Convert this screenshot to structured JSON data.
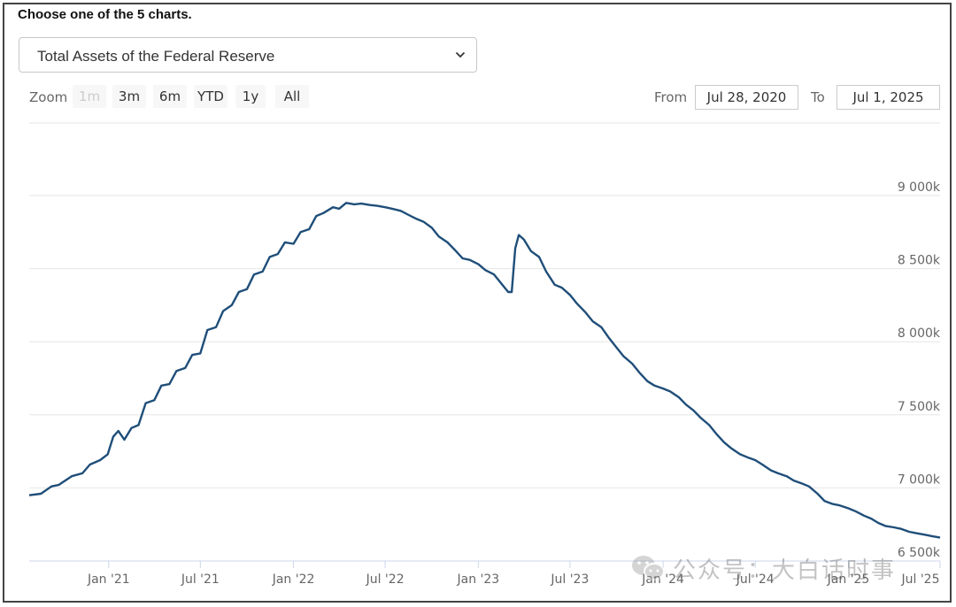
{
  "prompt": "Choose one of the 5 charts.",
  "selector": {
    "selected": "Total Assets of the Federal Reserve"
  },
  "zoom": {
    "label": "Zoom",
    "buttons": [
      {
        "label": "1m",
        "disabled": true
      },
      {
        "label": "3m",
        "disabled": false
      },
      {
        "label": "6m",
        "disabled": false
      },
      {
        "label": "YTD",
        "disabled": false
      },
      {
        "label": "1y",
        "disabled": false
      },
      {
        "label": "All",
        "disabled": false
      }
    ]
  },
  "range": {
    "from_label": "From",
    "from_value": "Jul 28, 2020",
    "to_label": "To",
    "to_value": "Jul 1, 2025"
  },
  "watermark": {
    "text": "公众号：大白话时事",
    "icon": "wechat-icon"
  },
  "colors": {
    "line": "#1f4e79",
    "grid": "#e6e6e6",
    "axis": "#ccd6eb"
  },
  "chart_data": {
    "type": "line",
    "title": "",
    "xlabel": "",
    "ylabel": "",
    "xlim": [
      "2020-07-28",
      "2025-07-01"
    ],
    "ylim": [
      6500,
      9000
    ],
    "grid": true,
    "y_ticks": [
      {
        "value": 6500,
        "label": "6 500k"
      },
      {
        "value": 7000,
        "label": "7 000k"
      },
      {
        "value": 7500,
        "label": "7 500k"
      },
      {
        "value": 8000,
        "label": "8 000k"
      },
      {
        "value": 8500,
        "label": "8 500k"
      },
      {
        "value": 9000,
        "label": "9 000k"
      }
    ],
    "x_ticks": [
      {
        "date": "2021-01-01",
        "label": "Jan '21"
      },
      {
        "date": "2021-07-01",
        "label": "Jul '21"
      },
      {
        "date": "2022-01-01",
        "label": "Jan '22"
      },
      {
        "date": "2022-07-01",
        "label": "Jul '22"
      },
      {
        "date": "2023-01-01",
        "label": "Jan '23"
      },
      {
        "date": "2023-07-01",
        "label": "Jul '23"
      },
      {
        "date": "2024-01-01",
        "label": "Jan '24"
      },
      {
        "date": "2024-07-01",
        "label": "Jul '24"
      },
      {
        "date": "2025-01-01",
        "label": "Jan '25"
      },
      {
        "date": "2025-07-01",
        "label": "Jul '25"
      }
    ],
    "series": [
      {
        "points": [
          [
            "2020-07-28",
            6950
          ],
          [
            "2020-08-20",
            6960
          ],
          [
            "2020-09-10",
            7010
          ],
          [
            "2020-09-24",
            7020
          ],
          [
            "2020-10-20",
            7080
          ],
          [
            "2020-11-10",
            7100
          ],
          [
            "2020-11-25",
            7160
          ],
          [
            "2020-12-15",
            7190
          ],
          [
            "2020-12-30",
            7230
          ],
          [
            "2021-01-10",
            7350
          ],
          [
            "2021-01-20",
            7390
          ],
          [
            "2021-02-01",
            7330
          ],
          [
            "2021-02-15",
            7410
          ],
          [
            "2021-03-01",
            7430
          ],
          [
            "2021-03-15",
            7580
          ],
          [
            "2021-04-01",
            7600
          ],
          [
            "2021-04-15",
            7700
          ],
          [
            "2021-05-01",
            7710
          ],
          [
            "2021-05-15",
            7800
          ],
          [
            "2021-06-01",
            7820
          ],
          [
            "2021-06-15",
            7910
          ],
          [
            "2021-07-01",
            7920
          ],
          [
            "2021-07-15",
            8080
          ],
          [
            "2021-08-01",
            8100
          ],
          [
            "2021-08-15",
            8210
          ],
          [
            "2021-09-01",
            8250
          ],
          [
            "2021-09-15",
            8340
          ],
          [
            "2021-10-01",
            8360
          ],
          [
            "2021-10-15",
            8460
          ],
          [
            "2021-11-01",
            8480
          ],
          [
            "2021-11-15",
            8580
          ],
          [
            "2021-12-01",
            8600
          ],
          [
            "2021-12-15",
            8680
          ],
          [
            "2022-01-01",
            8670
          ],
          [
            "2022-01-15",
            8750
          ],
          [
            "2022-02-01",
            8770
          ],
          [
            "2022-02-15",
            8860
          ],
          [
            "2022-03-01",
            8880
          ],
          [
            "2022-03-20",
            8920
          ],
          [
            "2022-04-01",
            8910
          ],
          [
            "2022-04-15",
            8950
          ],
          [
            "2022-05-01",
            8940
          ],
          [
            "2022-05-15",
            8945
          ],
          [
            "2022-06-01",
            8935
          ],
          [
            "2022-06-15",
            8930
          ],
          [
            "2022-07-01",
            8920
          ],
          [
            "2022-07-15",
            8910
          ],
          [
            "2022-08-01",
            8895
          ],
          [
            "2022-08-15",
            8870
          ],
          [
            "2022-09-01",
            8840
          ],
          [
            "2022-09-15",
            8820
          ],
          [
            "2022-10-01",
            8780
          ],
          [
            "2022-10-15",
            8720
          ],
          [
            "2022-11-01",
            8680
          ],
          [
            "2022-11-15",
            8630
          ],
          [
            "2022-12-01",
            8570
          ],
          [
            "2022-12-15",
            8560
          ],
          [
            "2023-01-01",
            8530
          ],
          [
            "2023-01-15",
            8490
          ],
          [
            "2023-02-01",
            8460
          ],
          [
            "2023-02-15",
            8400
          ],
          [
            "2023-03-01",
            8340
          ],
          [
            "2023-03-08",
            8340
          ],
          [
            "2023-03-15",
            8640
          ],
          [
            "2023-03-22",
            8730
          ],
          [
            "2023-04-01",
            8700
          ],
          [
            "2023-04-15",
            8620
          ],
          [
            "2023-05-01",
            8580
          ],
          [
            "2023-05-15",
            8480
          ],
          [
            "2023-06-01",
            8390
          ],
          [
            "2023-06-15",
            8370
          ],
          [
            "2023-07-01",
            8320
          ],
          [
            "2023-07-15",
            8260
          ],
          [
            "2023-08-01",
            8200
          ],
          [
            "2023-08-15",
            8140
          ],
          [
            "2023-09-01",
            8100
          ],
          [
            "2023-09-15",
            8030
          ],
          [
            "2023-10-01",
            7960
          ],
          [
            "2023-10-15",
            7900
          ],
          [
            "2023-11-01",
            7850
          ],
          [
            "2023-11-15",
            7790
          ],
          [
            "2023-12-01",
            7730
          ],
          [
            "2023-12-15",
            7700
          ],
          [
            "2024-01-01",
            7680
          ],
          [
            "2024-01-15",
            7660
          ],
          [
            "2024-02-01",
            7620
          ],
          [
            "2024-02-15",
            7570
          ],
          [
            "2024-03-01",
            7530
          ],
          [
            "2024-03-15",
            7480
          ],
          [
            "2024-04-01",
            7430
          ],
          [
            "2024-04-15",
            7370
          ],
          [
            "2024-05-01",
            7310
          ],
          [
            "2024-05-15",
            7270
          ],
          [
            "2024-06-01",
            7230
          ],
          [
            "2024-06-15",
            7210
          ],
          [
            "2024-07-01",
            7190
          ],
          [
            "2024-07-15",
            7160
          ],
          [
            "2024-08-01",
            7120
          ],
          [
            "2024-08-15",
            7100
          ],
          [
            "2024-09-01",
            7080
          ],
          [
            "2024-09-15",
            7050
          ],
          [
            "2024-10-01",
            7030
          ],
          [
            "2024-10-15",
            7010
          ],
          [
            "2024-11-01",
            6960
          ],
          [
            "2024-11-15",
            6910
          ],
          [
            "2024-12-01",
            6890
          ],
          [
            "2024-12-15",
            6880
          ],
          [
            "2025-01-01",
            6860
          ],
          [
            "2025-01-15",
            6840
          ],
          [
            "2025-02-01",
            6810
          ],
          [
            "2025-02-15",
            6790
          ],
          [
            "2025-03-01",
            6760
          ],
          [
            "2025-03-15",
            6740
          ],
          [
            "2025-04-01",
            6730
          ],
          [
            "2025-04-15",
            6720
          ],
          [
            "2025-05-01",
            6700
          ],
          [
            "2025-05-15",
            6690
          ],
          [
            "2025-06-01",
            6680
          ],
          [
            "2025-06-15",
            6670
          ],
          [
            "2025-07-01",
            6660
          ]
        ]
      }
    ]
  }
}
